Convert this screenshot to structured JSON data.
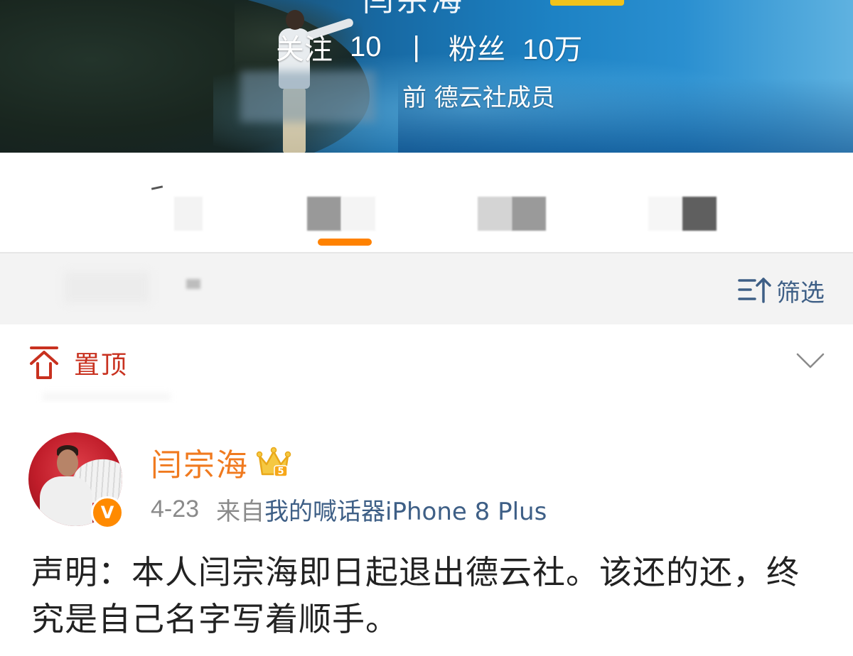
{
  "header": {
    "name_partial": "闫宗海",
    "follow_label": "关注",
    "follow_count": "10",
    "separator": "|",
    "fans_label": "粉丝",
    "fans_count": "10万",
    "description": "前 德云社成员"
  },
  "tabs": {
    "items": [
      {
        "label": ""
      },
      {
        "label": "",
        "active": true
      },
      {
        "label": ""
      },
      {
        "label": ""
      }
    ],
    "active_color": "#ff8200"
  },
  "filter": {
    "label": "筛选",
    "icon": "filter-sort-icon",
    "color": "#3e5f86"
  },
  "pinned": {
    "label": "置顶",
    "icon": "pin-top-icon",
    "color": "#c8311f",
    "expand_icon": "chevron-down-icon"
  },
  "post": {
    "author": "闫宗海",
    "author_color": "#f07a1f",
    "crown_icon": "crown-icon",
    "crown_level": "5",
    "verified_icon": "v-verified-icon",
    "verified_text": "V",
    "date": "4-23",
    "from_label": "来自",
    "source": "我的喊话器iPhone 8 Plus",
    "text": "声明：本人闫宗海即日起退出德云社。该还的还，终究是自己名字写着顺手。"
  }
}
